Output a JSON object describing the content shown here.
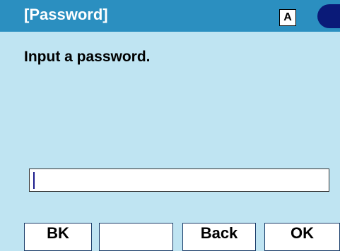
{
  "header": {
    "title": "[Password]",
    "input_mode": "A"
  },
  "main": {
    "prompt": "Input a password.",
    "password_value": ""
  },
  "softkeys": [
    {
      "label": "BK"
    },
    {
      "label": ""
    },
    {
      "label": "Back"
    },
    {
      "label": "OK"
    }
  ],
  "colors": {
    "header_bg": "#2b8fc0",
    "screen_bg": "#bfe4f2",
    "status_indicator": "#0a1a78"
  }
}
